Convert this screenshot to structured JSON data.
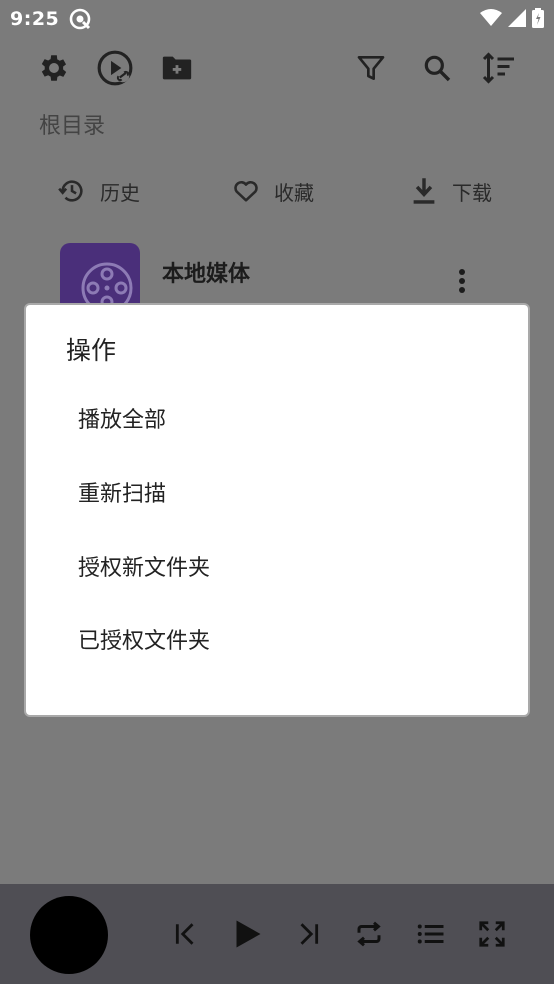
{
  "status": {
    "time": "9:25"
  },
  "breadcrumb": "根目录",
  "quick_nav": [
    {
      "label": "历史",
      "icon": "history-icon"
    },
    {
      "label": "收藏",
      "icon": "heart-icon"
    },
    {
      "label": "下载",
      "icon": "download-icon"
    }
  ],
  "media_item": {
    "title": "本地媒体"
  },
  "dialog": {
    "title": "操作",
    "items": [
      "播放全部",
      "重新扫描",
      "授权新文件夹",
      "已授权文件夹"
    ]
  },
  "colors": {
    "scrim": "#7b7b7b",
    "player_bar": "#4f4e54",
    "thumb": "#4a2f7a",
    "dialog_bg": "#ffffff"
  }
}
